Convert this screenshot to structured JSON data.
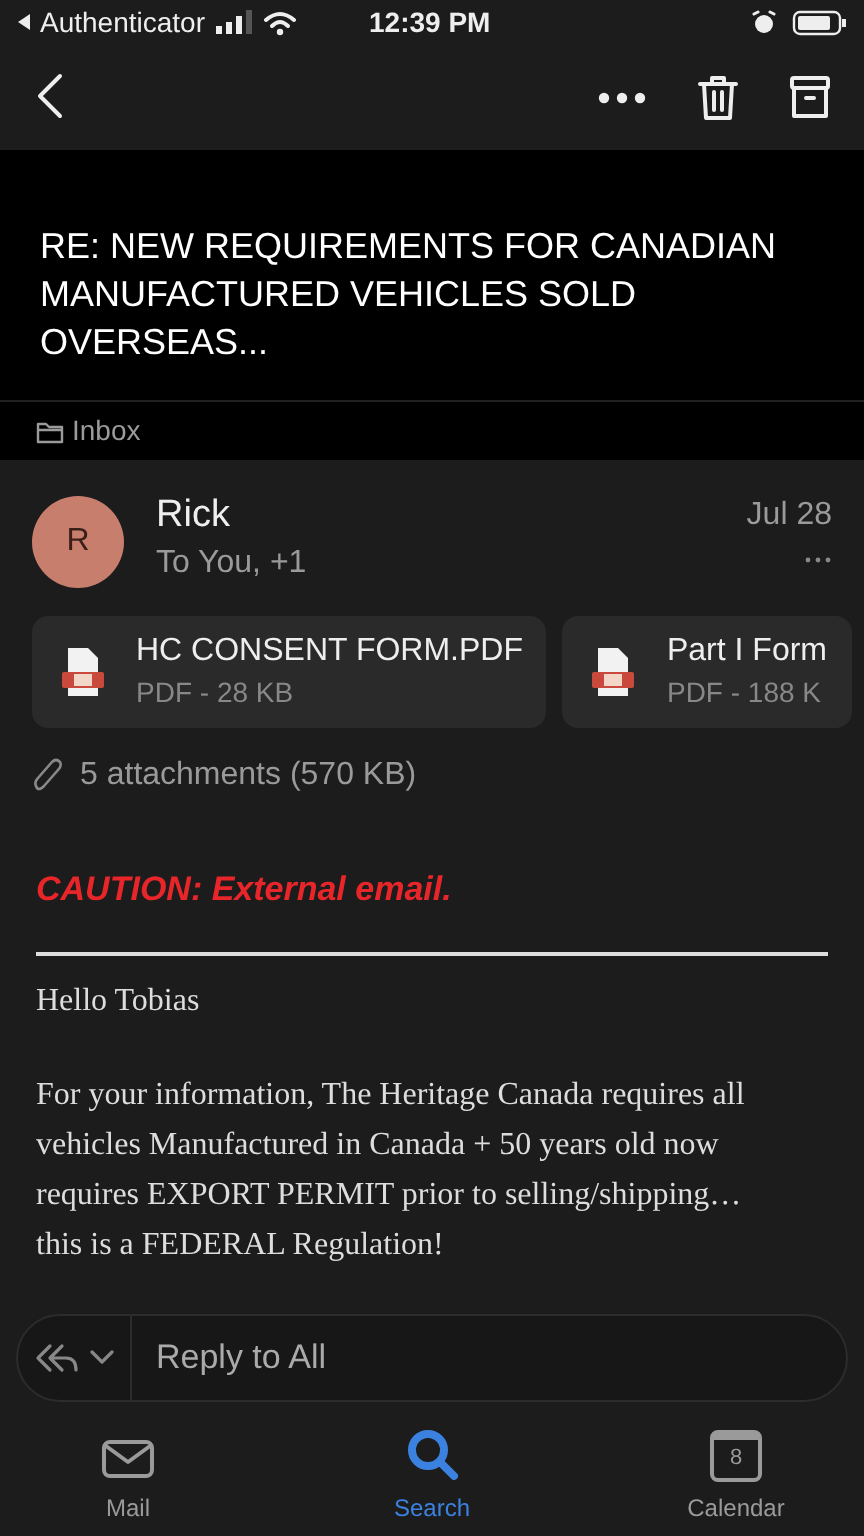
{
  "status_bar": {
    "back_app": "Authenticator",
    "time": "12:39 PM"
  },
  "subject": "RE: NEW REQUIREMENTS FOR CANADIAN MANUFACTURED VEHICLES SOLD OVERSEAS...",
  "folder": "Inbox",
  "message": {
    "avatar_initial": "R",
    "sender": "Rick",
    "recipients": "To You, +1",
    "date": "Jul 28",
    "attachments": [
      {
        "name": "HC CONSENT FORM.PDF",
        "info": "PDF - 28 KB"
      },
      {
        "name": "Part I Form",
        "info": "PDF - 188 K"
      }
    ],
    "attachments_summary": "5 attachments (570 KB)",
    "caution": "CAUTION: External email.",
    "body": [
      "Hello Tobias",
      "For your information, The Heritage Canada requires all vehicles Manufactured in Canada + 50 years old now requires EXPORT PERMIT prior to selling/shipping… this is a FEDERAL Regulation!"
    ]
  },
  "reply": {
    "placeholder": "Reply to All"
  },
  "tabs": [
    {
      "label": "Mail",
      "kind": "mail",
      "selected": false
    },
    {
      "label": "Search",
      "kind": "search",
      "selected": true
    },
    {
      "label": "Calendar",
      "kind": "calendar",
      "selected": false,
      "day": "8"
    }
  ]
}
